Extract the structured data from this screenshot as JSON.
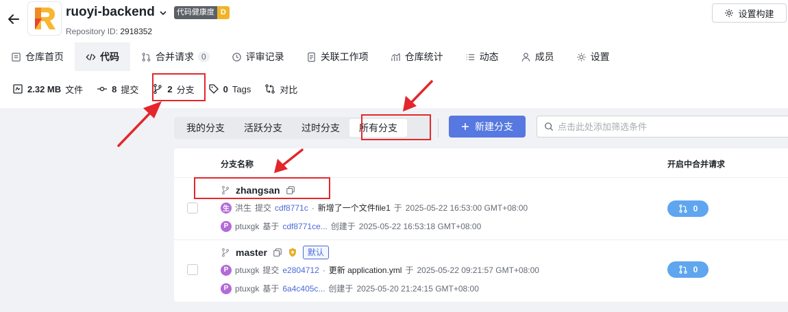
{
  "header": {
    "repo_name": "ruoyi-backend",
    "health_label": "代码健康度",
    "health_grade": "D",
    "repo_id_label": "Repository ID:",
    "repo_id": "2918352",
    "build_button": "设置构建"
  },
  "tabs": [
    {
      "label": "仓库首页",
      "icon": "file-icon"
    },
    {
      "label": "代码",
      "icon": "code-icon",
      "active": true
    },
    {
      "label": "合并请求",
      "icon": "merge-request-icon",
      "count": "0"
    },
    {
      "label": "评审记录",
      "icon": "review-icon"
    },
    {
      "label": "关联工作项",
      "icon": "workitem-icon"
    },
    {
      "label": "仓库统计",
      "icon": "chart-icon"
    },
    {
      "label": "动态",
      "icon": "list-icon"
    },
    {
      "label": "成员",
      "icon": "user-icon"
    },
    {
      "label": "设置",
      "icon": "gear-icon"
    }
  ],
  "stats": {
    "size_value": "2.32 MB",
    "size_label": "文件",
    "commits_value": "8",
    "commits_label": "提交",
    "branches_value": "2",
    "branches_label": "分支",
    "tags_value": "0",
    "tags_label": "Tags",
    "compare_label": "对比"
  },
  "filters": {
    "tabs": [
      "我的分支",
      "活跃分支",
      "过时分支",
      "所有分支"
    ],
    "active": "所有分支",
    "new_branch": "新建分支",
    "search_placeholder": "点击此处添加筛选条件"
  },
  "table": {
    "col_name": "分支名称",
    "col_mr": "开启中合并请求",
    "rows": [
      {
        "name": "zhangsan",
        "is_default": false,
        "commit": {
          "avatar": "生",
          "avatar_color": "#b36bd8",
          "author": "洪生",
          "verb": "提交",
          "sha": "cdf8771c",
          "message": "新增了一个文件file1",
          "time_prefix": "于",
          "time": "2025-05-22 16:53:00 GMT+08:00"
        },
        "created": {
          "avatar": "P",
          "avatar_color": "#b36bd8",
          "author": "ptuxgk",
          "verb": "基于",
          "sha": "cdf8771ce...",
          "time_prefix": "创建于",
          "time": "2025-05-22 16:53:18 GMT+08:00"
        },
        "mr_count": "0"
      },
      {
        "name": "master",
        "is_default": true,
        "default_label": "默认",
        "commit": {
          "avatar": "P",
          "avatar_color": "#b36bd8",
          "author": "ptuxgk",
          "verb": "提交",
          "sha": "e2804712",
          "message": "更新 application.yml",
          "time_prefix": "于",
          "time": "2025-05-22 09:21:57 GMT+08:00"
        },
        "created": {
          "avatar": "P",
          "avatar_color": "#b36bd8",
          "author": "ptuxgk",
          "verb": "基于",
          "sha": "6a4c405c...",
          "time_prefix": "创建于",
          "time": "2025-05-20 21:24:15 GMT+08:00"
        },
        "mr_count": "0"
      }
    ]
  },
  "colors": {
    "accent": "#5678e0",
    "annotation": "#e3262b",
    "link": "#4a6ad8",
    "mr_pill": "#5fa6ef"
  }
}
